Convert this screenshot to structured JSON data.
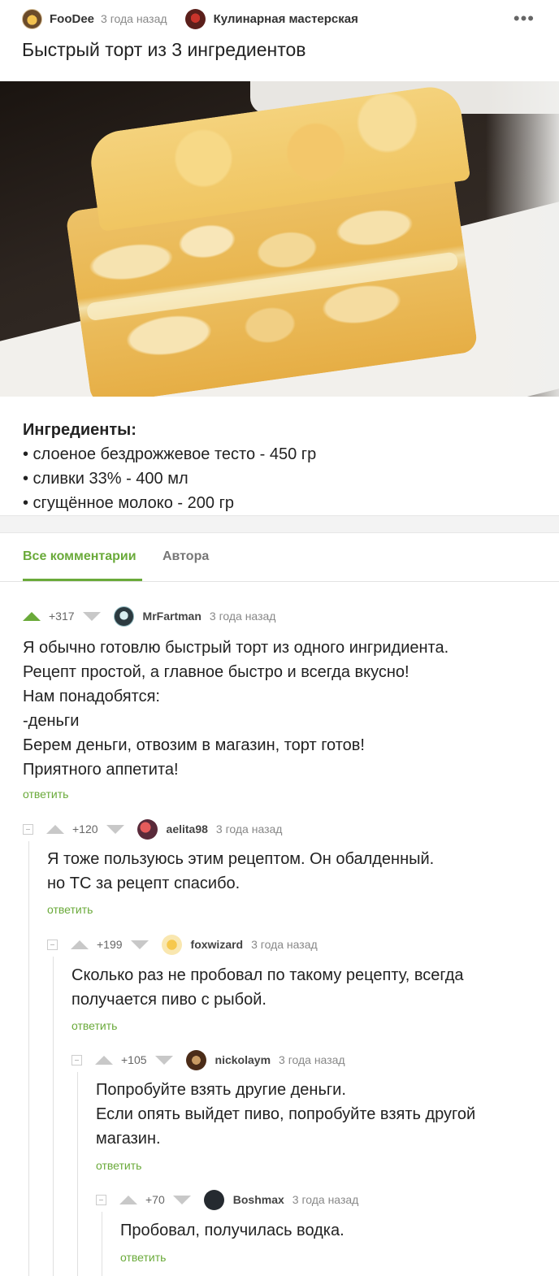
{
  "post": {
    "author": "FooDee",
    "time": "3 года назад",
    "community": "Кулинарная мастерская",
    "more_label": "•••",
    "title": "Быстрый торт из 3 ингредиентов",
    "ingredients_title": "Ингредиенты:",
    "ingredients": [
      "• слоеное бездрожжевое тесто - 450 гр",
      "• сливки 33% - 400 мл",
      "• сгущённое молоко - 200 гр"
    ]
  },
  "tabs": {
    "all": "Все комментарии",
    "author": "Автора"
  },
  "comments": [
    {
      "score": "+317",
      "author": "MrFartman",
      "time": "3 года назад",
      "lines": [
        "Я обычно готовлю быстрый торт из одного ингридиента.",
        "Рецепт простой, а главное быстро и всегда вкусно!",
        "Нам понадобятся:",
        "-деньги",
        "Берем деньги, отвозим в магазин, торт готов!",
        "Приятного аппетита!"
      ],
      "reply": "ответить"
    },
    {
      "score": "+120",
      "author": "aelita98",
      "time": "3 года назад",
      "lines": [
        "Я тоже пользуюсь этим рецептом. Он обалденный.",
        "но ТС за рецепт спасибо."
      ],
      "reply": "ответить"
    },
    {
      "score": "+199",
      "author": "foxwizard",
      "time": "3 года назад",
      "lines": [
        "Сколько раз не пробовал по такому рецепту, всегда",
        "получается пиво с рыбой."
      ],
      "reply": "ответить"
    },
    {
      "score": "+105",
      "author": "nickolaym",
      "time": "3 года назад",
      "lines": [
        "Попробуйте взять другие деньги.",
        "Если опять выйдет пиво, попробуйте взять другой",
        "магазин."
      ],
      "reply": "ответить"
    },
    {
      "score": "+70",
      "author": "Boshmax",
      "time": "3 года назад",
      "lines": [
        "Пробовал, получилась водка."
      ],
      "reply": "ответить"
    }
  ],
  "colors": {
    "accent": "#6aaa3a",
    "upvote_active": "#6aaa3a",
    "vote_inactive": "#c8c8c8"
  }
}
